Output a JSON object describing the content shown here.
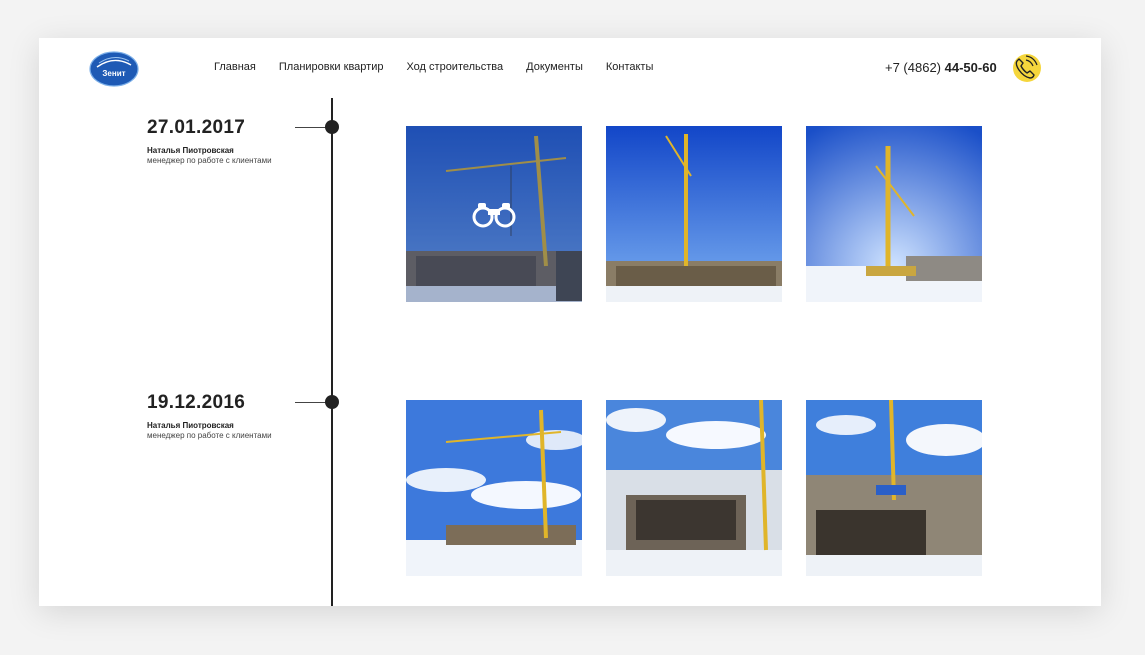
{
  "header": {
    "logo_text": "Зенит",
    "nav": [
      {
        "label": "Главная"
      },
      {
        "label": "Планировки квартир"
      },
      {
        "label": "Ход строительства"
      },
      {
        "label": "Документы"
      },
      {
        "label": "Контакты"
      }
    ],
    "phone_prefix": "+7 (4862)",
    "phone_number": "44-50-60",
    "call_icon": "phone-call-icon"
  },
  "timeline": [
    {
      "date": "27.01.2017",
      "author": "Наталья Пиотровская",
      "role": "менеджер по работе с клиентами",
      "photos": [
        {
          "icon": "binoculars-icon",
          "hovered": true
        },
        {
          "hovered": false
        },
        {
          "hovered": false
        }
      ]
    },
    {
      "date": "19.12.2016",
      "author": "Наталья Пиотровская",
      "role": "менеджер по работе с клиентами",
      "photos": [
        {
          "hovered": false
        },
        {
          "hovered": false
        },
        {
          "hovered": false
        }
      ]
    }
  ],
  "colors": {
    "accent": "#f5d63c",
    "timeline": "#222222",
    "sky": "#1c5fd6",
    "crane": "#e0b52a"
  }
}
